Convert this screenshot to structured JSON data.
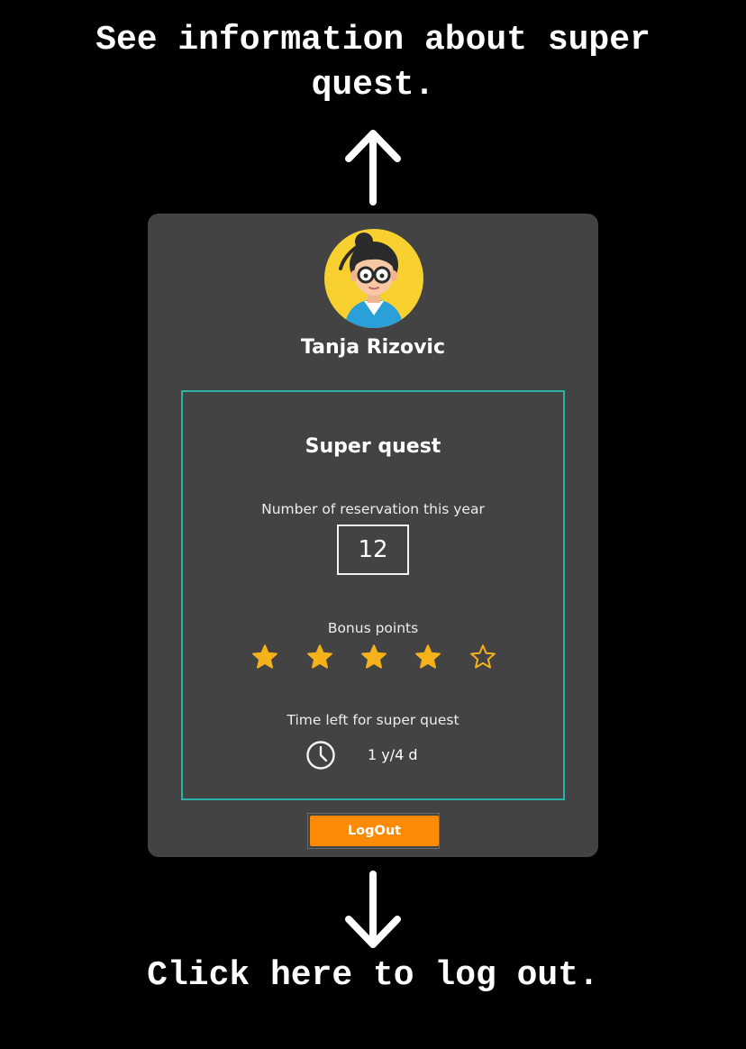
{
  "annotations": {
    "top_text": "See information about super quest.",
    "bottom_text": "Click here to log out."
  },
  "profile": {
    "name": "Tanja Rizovic",
    "avatar_icon": "avatar-girl-with-glasses"
  },
  "super_quest": {
    "title": "Super quest",
    "reservations_label": "Number of reservation this year",
    "reservations_count": "12",
    "bonus_label": "Bonus points",
    "bonus_rating": 4,
    "bonus_max": 5,
    "time_left_label": "Time left for super quest",
    "time_left_value": "1 y/4 d"
  },
  "logout": {
    "label": "LogOut"
  },
  "colors": {
    "background": "#000000",
    "card": "#434343",
    "quest_border": "#2cb3a9",
    "star": "#f5b21b",
    "button": "#ff8a05",
    "avatar_bg": "#f8d030"
  }
}
